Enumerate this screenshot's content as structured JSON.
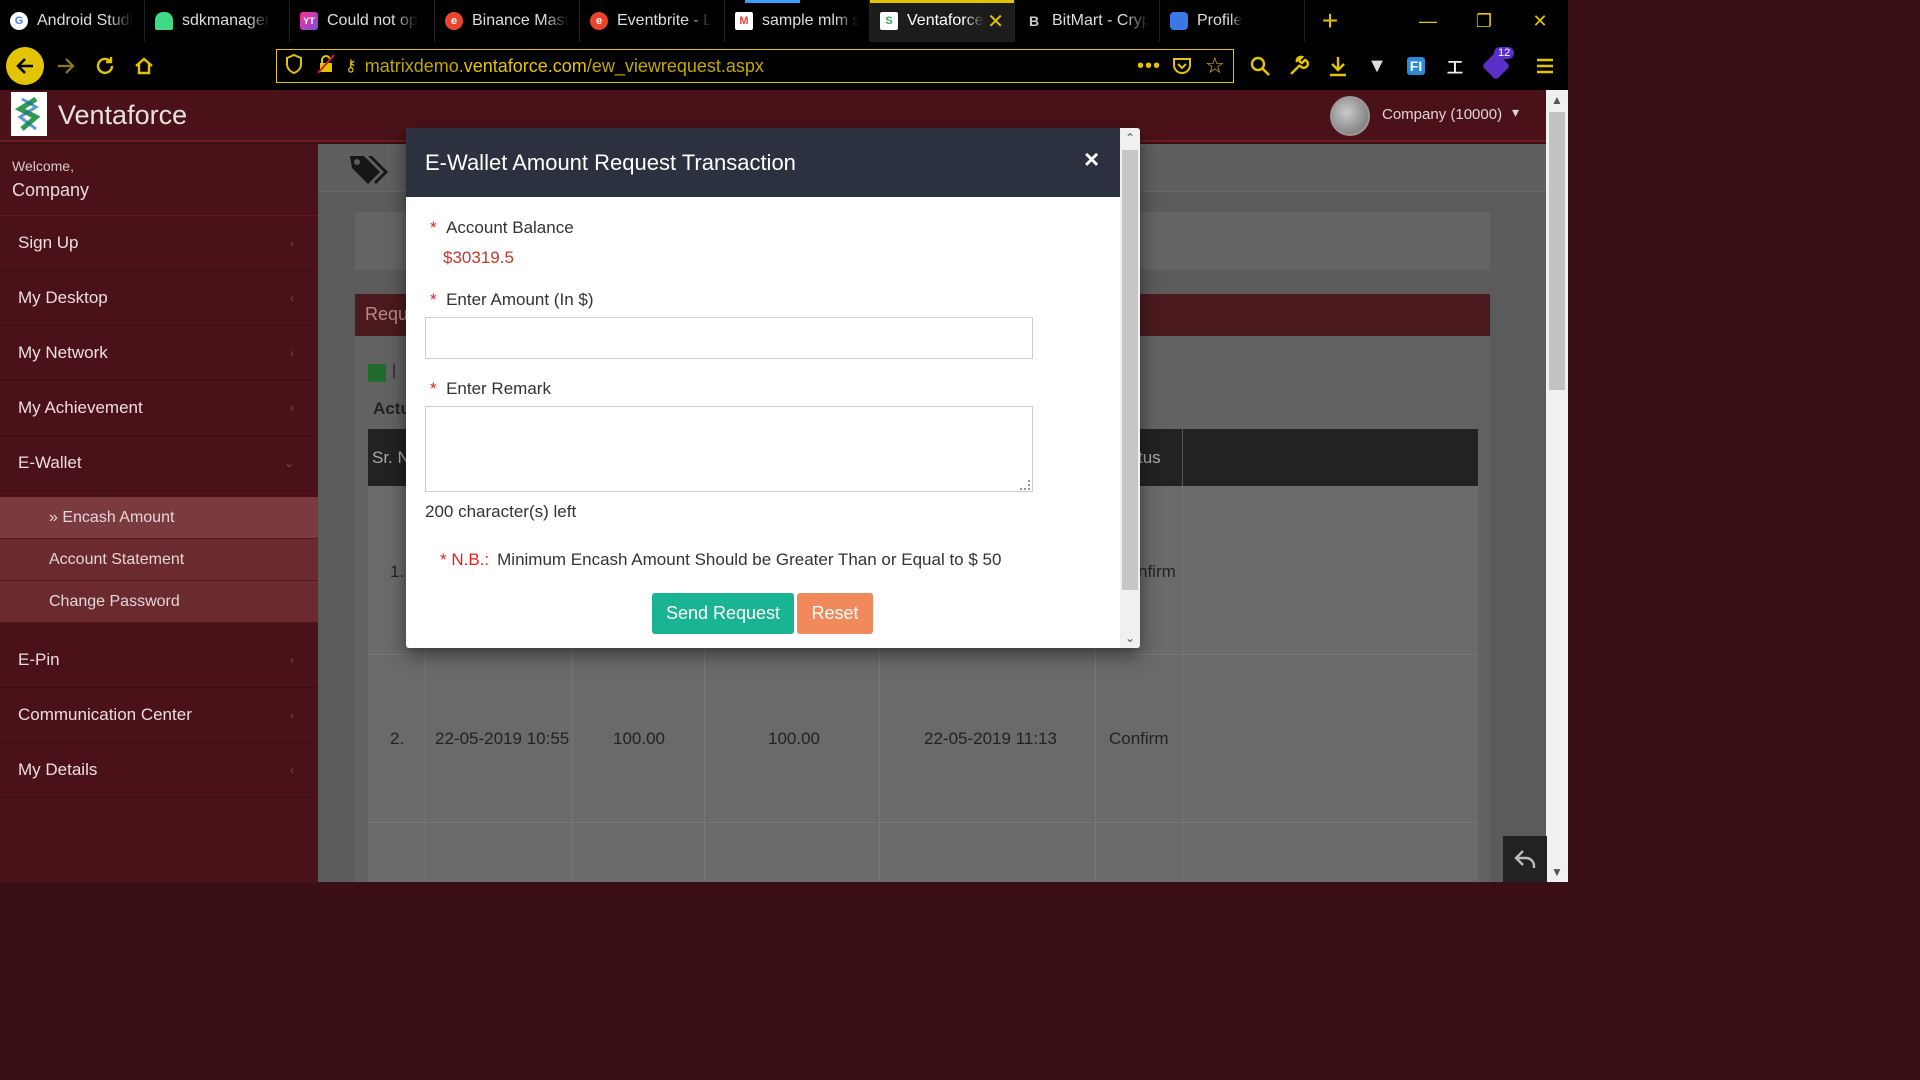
{
  "browser": {
    "tabs": [
      {
        "title": "Android Studi",
        "icon": "google-icon",
        "color": "#4285f4"
      },
      {
        "title": "sdkmanager",
        "icon": "android-icon",
        "color": "#3ddc84"
      },
      {
        "title": "Could not op",
        "icon": "jetbrains-icon",
        "color": "#7b4de0"
      },
      {
        "title": "Binance Mast",
        "icon": "edge-e-icon",
        "color": "#e8452c"
      },
      {
        "title": "Eventbrite - L",
        "icon": "eventbrite-icon",
        "color": "#e8452c"
      },
      {
        "title": "sample mlm s",
        "icon": "gmail-icon",
        "color": "#ea4335"
      },
      {
        "title": "Ventaforce",
        "icon": "ventaforce-icon",
        "color": "#3aa55a",
        "active": true
      },
      {
        "title": "BitMart - Cryp",
        "icon": "bitmart-icon",
        "color": "#aaaaaa"
      },
      {
        "title": "Profile",
        "icon": "profile-shield-icon",
        "color": "#3a78e8"
      }
    ],
    "url": {
      "prefix": "matrixdemo.",
      "domain": "ventaforce.com",
      "path": "/ew_viewrequest.aspx"
    },
    "extension_badge": "12",
    "accent": "#e3c400"
  },
  "app": {
    "brand": "Ventaforce",
    "user": "Company (10000)",
    "welcome": "Welcome,",
    "welcome_name": "Company"
  },
  "sidebar": {
    "items": [
      {
        "label": "Sign Up"
      },
      {
        "label": "My Desktop"
      },
      {
        "label": "My Network"
      },
      {
        "label": "My Achievement"
      },
      {
        "label": "E-Wallet"
      },
      {
        "label": "E-Pin"
      },
      {
        "label": "Communication Center"
      },
      {
        "label": "My Details"
      }
    ],
    "ewallet_sub": [
      {
        "label": "» Encash Amount"
      },
      {
        "label": "Account Statement"
      },
      {
        "label": "Change Password"
      }
    ]
  },
  "background": {
    "panel_header": "Requ",
    "filter_label": "Actu",
    "col_first": "Sr. N",
    "col_status": "tus",
    "rows": [
      {
        "sr": "1.",
        "status": "nfirm"
      },
      {
        "sr": "2.",
        "date": "22-05-2019 10:55",
        "amount": "100.00",
        "net": "100.00",
        "date2": "22-05-2019 11:13",
        "status": "Confirm"
      }
    ]
  },
  "modal": {
    "title": "E-Wallet Amount Request Transaction",
    "close": "×",
    "balance_label": "Account Balance",
    "balance_value": "$30319.5",
    "amount_label": "Enter Amount (In $)",
    "amount_value": "",
    "remark_label": "Enter Remark",
    "remark_value": "",
    "chars_left": "200 character(s) left",
    "nb_label": "* N.B.:",
    "nb_text": "Minimum Encash Amount Should be Greater Than or Equal to $ 50",
    "send_label": "Send Request",
    "reset_label": "Reset"
  }
}
